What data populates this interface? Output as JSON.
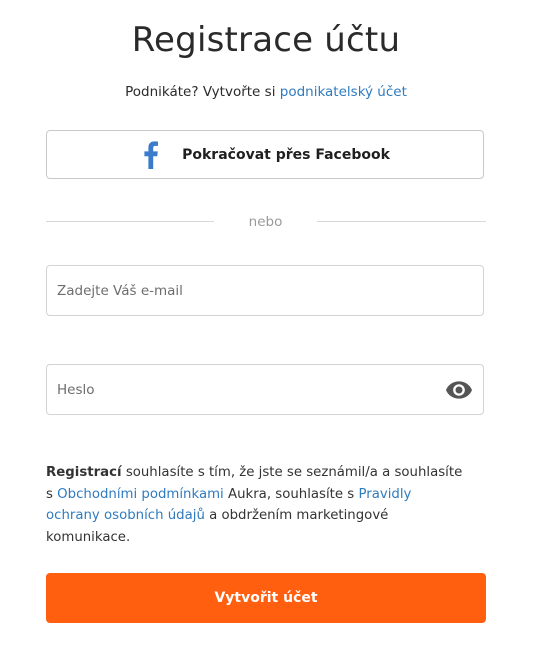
{
  "title": "Registrace účtu",
  "business": {
    "prefix": "Podnikáte? Vytvořte si",
    "link": "podnikatelský účet"
  },
  "facebook": {
    "label": "Pokračovat přes Facebook",
    "icon": "facebook-icon",
    "color": "#3b7bcc"
  },
  "divider": {
    "text": "nebo"
  },
  "email": {
    "placeholder": "Zadejte Váš e-mail",
    "value": ""
  },
  "password": {
    "placeholder": "Heslo",
    "value": "",
    "icon": "eye-icon"
  },
  "terms": {
    "bold": "Registrací",
    "text1": "souhlasíte s tím, že jste se seznámil/a a souhlasíte s",
    "link1": "Obchodními podmínkami",
    "text2": "Aukra, souhlasíte s",
    "link2": "Pravidly ochrany osobních údajů",
    "text3": "a obdržením marketingové komunikace."
  },
  "submit": {
    "label": "Vytvořit účet",
    "color": "#ff5f0f"
  }
}
